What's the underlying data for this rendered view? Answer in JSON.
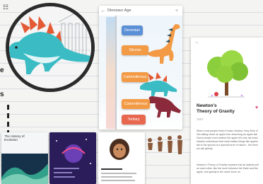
{
  "left_panel": {
    "fragment_letters": [
      "e",
      "s"
    ]
  },
  "dinosaur_app": {
    "title": "Dinosaur Age",
    "eras": [
      {
        "label": "Devonian",
        "color": "#5b8fd6"
      },
      {
        "label": "Silurian",
        "color": "#f39a45"
      },
      {
        "label": "Carboniferous",
        "color": "#f39a45"
      },
      {
        "label": "Tertiary",
        "color": "#e8684f"
      }
    ]
  },
  "cards": {
    "history_card": {
      "title_line1": "The History of",
      "title_line2": "Evolution"
    }
  },
  "newton_app": {
    "title_line1": "Newton's",
    "title_line2": "Theory of Gravity",
    "subtitle": "1687",
    "para1": "When most people think of Isaac Newton, they think of him sitting under an apple tree observing an apple fall. Some people even believe the apple fell onto his head. Newton understood that what makes things like apples fall to the ground is a special force of nature - the force we call gravity.",
    "para2": "Newton's Theory of Gravity explains that all objects pull on each other, like the force between the Earth and the apple, and gravity is the same force on"
  }
}
